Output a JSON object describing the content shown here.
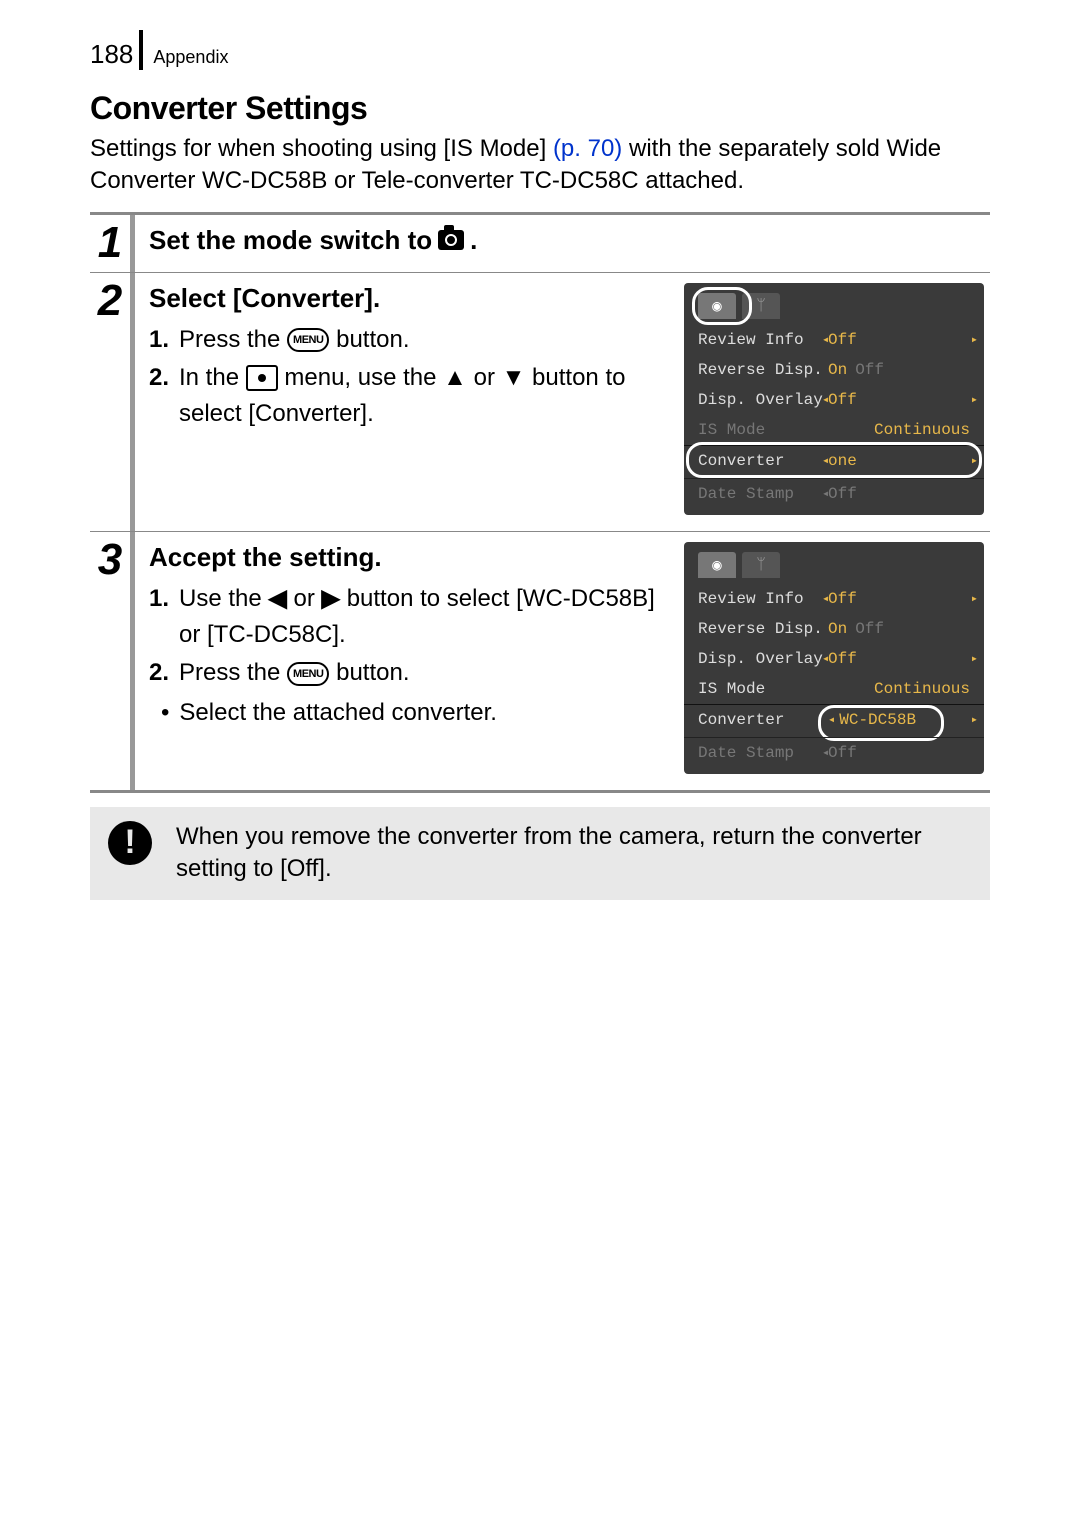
{
  "header": {
    "page_number": "188",
    "section": "Appendix"
  },
  "title": "Converter Settings",
  "intro": {
    "part1": "Settings for when shooting using [IS Mode] ",
    "link": "(p. 70)",
    "part2": " with the separately sold Wide Converter WC-DC58B or Tele-converter TC-DC58C attached."
  },
  "steps": {
    "s1": {
      "num": "1",
      "heading_pre": "Set the mode switch to ",
      "heading_post": "."
    },
    "s2": {
      "num": "2",
      "heading": "Select [Converter].",
      "li1": {
        "n": "1.",
        "pre": "Press the ",
        "btn": "MENU",
        "post": " button."
      },
      "li2": {
        "n": "2.",
        "pre": "In the ",
        "mid": " menu, use the ",
        "or": " or ",
        "post": " button to select [Converter]."
      }
    },
    "s3": {
      "num": "3",
      "heading": "Accept the setting.",
      "li1": {
        "n": "1.",
        "pre": "Use the ",
        "or": " or ",
        "post": " button to select [WC-DC58B] or [TC-DC58C]."
      },
      "li2": {
        "n": "2.",
        "pre": "Press the ",
        "btn": "MENU",
        "post": " button."
      },
      "bullet": "Select the attached converter."
    }
  },
  "lcd1": {
    "rows": {
      "r1": {
        "label": "Review Info",
        "val": "Off"
      },
      "r2": {
        "label": "Reverse Disp.",
        "val_on": "On",
        "val_off": "Off"
      },
      "r3": {
        "label": "Disp. Overlay",
        "val": "Off"
      },
      "r4": {
        "label": "IS Mode",
        "val": "Continuous"
      },
      "r5": {
        "label": "Converter",
        "val": "one"
      },
      "r6": {
        "label": "Date Stamp",
        "val": "Off"
      }
    }
  },
  "lcd2": {
    "rows": {
      "r1": {
        "label": "Review Info",
        "val": "Off"
      },
      "r2": {
        "label": "Reverse Disp.",
        "val_on": "On",
        "val_off": "Off"
      },
      "r3": {
        "label": "Disp. Overlay",
        "val": "Off"
      },
      "r4": {
        "label": "IS Mode",
        "val": "Continuous"
      },
      "r5": {
        "label": "Converter",
        "val": "WC-DC58B"
      },
      "r6": {
        "label": "Date Stamp",
        "val": "Off"
      }
    }
  },
  "note": "When you remove the converter from the camera, return the converter setting to [Off]."
}
